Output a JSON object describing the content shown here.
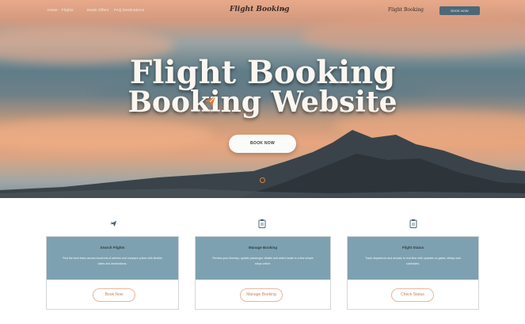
{
  "nav": {
    "links": [
      "Home",
      "Flights",
      "Deals Offers",
      "FAQ Destinations"
    ],
    "logo": "Flight Booking",
    "logo_mark": "✈",
    "right_text": "Flight Booking",
    "cta": "BOOK NOW"
  },
  "hero": {
    "title_line1": "Flight Booking",
    "title_line2": "Booking Website",
    "button": "BOOK NOW"
  },
  "cards": [
    {
      "title": "Search Flights",
      "text": "Find the best fares across hundreds of airlines and compare prices with flexible dates and destinations.",
      "button": "Book Now"
    },
    {
      "title": "Manage Booking",
      "text": "Review your itinerary, update passenger details and select seats in a few simple steps online.",
      "button": "Manage Booking"
    },
    {
      "title": "Flight Status",
      "text": "Track departures and arrivals in real time with updates on gates, delays and schedules.",
      "button": "Check Status"
    }
  ],
  "icons": [
    "plane-icon",
    "clipboard-icon",
    "clipboard-icon"
  ],
  "colors": {
    "accent": "#4c6878",
    "card_header": "#7ea1b1",
    "button_outline": "#e7b79a"
  }
}
